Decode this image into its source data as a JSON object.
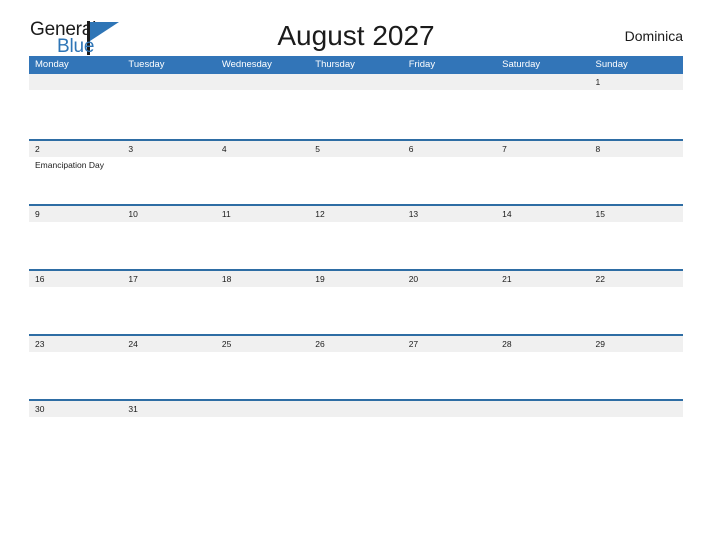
{
  "brand": {
    "name_part1": "General",
    "name_part2": "Blue",
    "logo_icon": "flag-triangle-icon",
    "color_primary": "#2e75b6",
    "color_text": "#1b1b1b"
  },
  "header": {
    "title": "August 2027",
    "country": "Dominica"
  },
  "calendar": {
    "header_bg": "#3275b8",
    "row_divider_color": "#2e6da4",
    "day_band_bg": "#f0f0f0",
    "weekdays": [
      "Monday",
      "Tuesday",
      "Wednesday",
      "Thursday",
      "Friday",
      "Saturday",
      "Sunday"
    ],
    "weeks": [
      [
        {
          "day": "",
          "events": []
        },
        {
          "day": "",
          "events": []
        },
        {
          "day": "",
          "events": []
        },
        {
          "day": "",
          "events": []
        },
        {
          "day": "",
          "events": []
        },
        {
          "day": "",
          "events": []
        },
        {
          "day": "1",
          "events": []
        }
      ],
      [
        {
          "day": "2",
          "events": [
            "Emancipation Day"
          ]
        },
        {
          "day": "3",
          "events": []
        },
        {
          "day": "4",
          "events": []
        },
        {
          "day": "5",
          "events": []
        },
        {
          "day": "6",
          "events": []
        },
        {
          "day": "7",
          "events": []
        },
        {
          "day": "8",
          "events": []
        }
      ],
      [
        {
          "day": "9",
          "events": []
        },
        {
          "day": "10",
          "events": []
        },
        {
          "day": "11",
          "events": []
        },
        {
          "day": "12",
          "events": []
        },
        {
          "day": "13",
          "events": []
        },
        {
          "day": "14",
          "events": []
        },
        {
          "day": "15",
          "events": []
        }
      ],
      [
        {
          "day": "16",
          "events": []
        },
        {
          "day": "17",
          "events": []
        },
        {
          "day": "18",
          "events": []
        },
        {
          "day": "19",
          "events": []
        },
        {
          "day": "20",
          "events": []
        },
        {
          "day": "21",
          "events": []
        },
        {
          "day": "22",
          "events": []
        }
      ],
      [
        {
          "day": "23",
          "events": []
        },
        {
          "day": "24",
          "events": []
        },
        {
          "day": "25",
          "events": []
        },
        {
          "day": "26",
          "events": []
        },
        {
          "day": "27",
          "events": []
        },
        {
          "day": "28",
          "events": []
        },
        {
          "day": "29",
          "events": []
        }
      ],
      [
        {
          "day": "30",
          "events": []
        },
        {
          "day": "31",
          "events": []
        },
        {
          "day": "",
          "events": []
        },
        {
          "day": "",
          "events": []
        },
        {
          "day": "",
          "events": []
        },
        {
          "day": "",
          "events": []
        },
        {
          "day": "",
          "events": []
        }
      ]
    ]
  }
}
